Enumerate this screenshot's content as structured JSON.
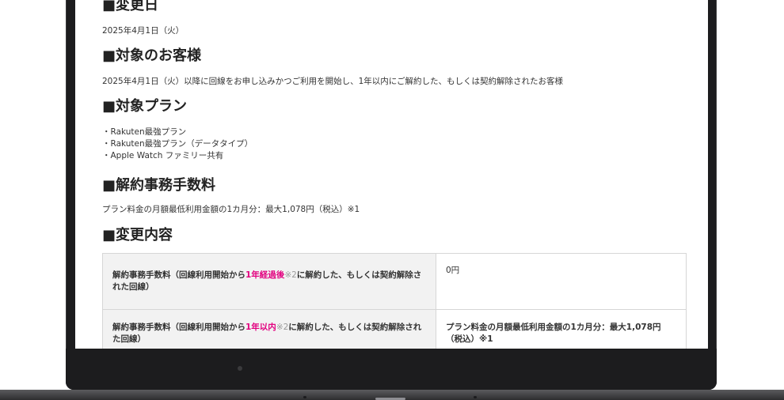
{
  "sections": {
    "date": {
      "heading": "■変更日",
      "text": "2025年4月1日（火）"
    },
    "customers": {
      "heading": "■対象のお客様",
      "text": "2025年4月1日（火）以降に回線をお申し込みかつご利用を開始し、1年以内にご解約した、もしくは契約解除されたお客様"
    },
    "plans": {
      "heading": "■対象プラン",
      "items": [
        "・Rakuten最強プラン",
        "・Rakuten最強プラン（データタイプ）",
        "・Apple Watch ファミリー共有"
      ]
    },
    "fee": {
      "heading": "■解約事務手数料",
      "text": "プラン料金の月額最低利用金額の1カ月分：最大1,078円（税込）※1"
    },
    "changes": {
      "heading": "■変更内容",
      "rows": [
        {
          "label_prefix": "解約事務手数料（回線利用開始から",
          "label_accent": "1年経過後",
          "label_note": "※2",
          "label_suffix": "に解約した、もしくは契約解除された回線）",
          "value": "0円"
        },
        {
          "label_prefix": "解約事務手数料（回線利用開始から",
          "label_accent": "1年以内",
          "label_note": "※2",
          "label_suffix": "に解約した、もしくは契約解除された回線）",
          "value": "プラン料金の月額最低利用金額の1カ月分：最大1,078円（税込）※1"
        }
      ]
    }
  },
  "colors": {
    "accent": "#e2007f",
    "bezel": "#1c1c1e",
    "table_label_bg": "#f2f2f2"
  }
}
